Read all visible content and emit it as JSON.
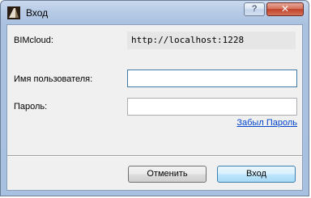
{
  "window": {
    "title": "Вход",
    "help_label": "?",
    "close_label": "✕"
  },
  "form": {
    "server_label": "BIMcloud:",
    "server_value": "http://localhost:1228",
    "username_label": "Имя пользователя:",
    "username_value": "",
    "password_label": "Пароль:",
    "password_value": "",
    "forgot_password_link": "Забыл Пароль"
  },
  "buttons": {
    "cancel_label": "Отменить",
    "login_label": "Вход"
  },
  "icons": {
    "app": "archicad-app-icon",
    "help": "help-icon",
    "close": "close-icon"
  }
}
